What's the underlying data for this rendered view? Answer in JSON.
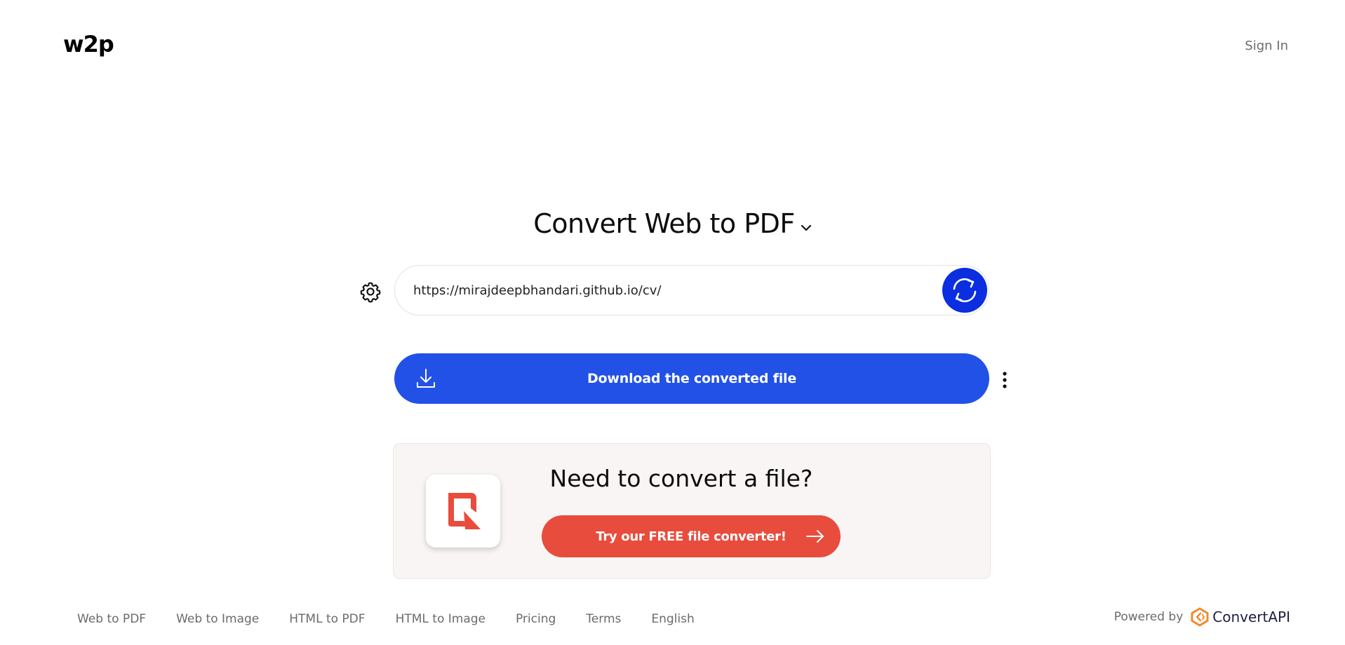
{
  "header": {
    "logo": "w2p",
    "sign_in": "Sign In"
  },
  "main": {
    "title": "Convert Web to PDF",
    "url_value": "https://mirajdeepbhandari.github.io/cv/",
    "download_label": "Download the converted file"
  },
  "promo": {
    "title": "Need to convert a file?",
    "button_label": "Try our FREE file converter!"
  },
  "footer": {
    "links": [
      "Web to PDF",
      "Web to Image",
      "HTML to PDF",
      "HTML to Image",
      "Pricing",
      "Terms",
      "English"
    ],
    "powered_by": "Powered by",
    "brand": "ConvertAPI"
  },
  "colors": {
    "primary_blue": "#2251e8",
    "convert_blue": "#0a2ee0",
    "promo_red": "#e84c3d",
    "brand_orange": "#f08a2c"
  },
  "icons": {
    "settings": "gear-icon",
    "convert": "refresh-icon",
    "download": "download-icon",
    "more": "kebab-menu-icon",
    "title_dropdown": "chevron-down-icon",
    "promo_arrow": "arrow-right-icon"
  }
}
